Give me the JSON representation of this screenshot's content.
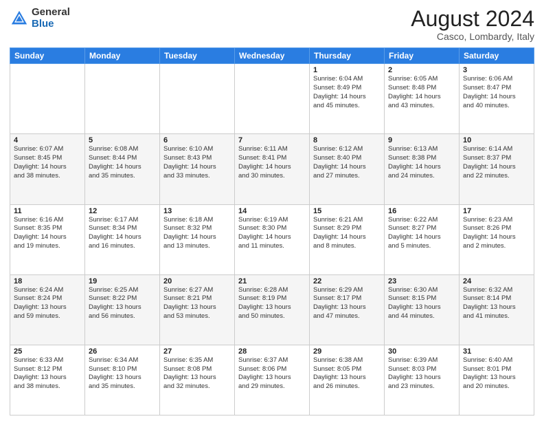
{
  "header": {
    "logo_general": "General",
    "logo_blue": "Blue",
    "month_title": "August 2024",
    "location": "Casco, Lombardy, Italy"
  },
  "weekdays": [
    "Sunday",
    "Monday",
    "Tuesday",
    "Wednesday",
    "Thursday",
    "Friday",
    "Saturday"
  ],
  "weeks": [
    [
      {
        "day": "",
        "info": ""
      },
      {
        "day": "",
        "info": ""
      },
      {
        "day": "",
        "info": ""
      },
      {
        "day": "",
        "info": ""
      },
      {
        "day": "1",
        "info": "Sunrise: 6:04 AM\nSunset: 8:49 PM\nDaylight: 14 hours\nand 45 minutes."
      },
      {
        "day": "2",
        "info": "Sunrise: 6:05 AM\nSunset: 8:48 PM\nDaylight: 14 hours\nand 43 minutes."
      },
      {
        "day": "3",
        "info": "Sunrise: 6:06 AM\nSunset: 8:47 PM\nDaylight: 14 hours\nand 40 minutes."
      }
    ],
    [
      {
        "day": "4",
        "info": "Sunrise: 6:07 AM\nSunset: 8:45 PM\nDaylight: 14 hours\nand 38 minutes."
      },
      {
        "day": "5",
        "info": "Sunrise: 6:08 AM\nSunset: 8:44 PM\nDaylight: 14 hours\nand 35 minutes."
      },
      {
        "day": "6",
        "info": "Sunrise: 6:10 AM\nSunset: 8:43 PM\nDaylight: 14 hours\nand 33 minutes."
      },
      {
        "day": "7",
        "info": "Sunrise: 6:11 AM\nSunset: 8:41 PM\nDaylight: 14 hours\nand 30 minutes."
      },
      {
        "day": "8",
        "info": "Sunrise: 6:12 AM\nSunset: 8:40 PM\nDaylight: 14 hours\nand 27 minutes."
      },
      {
        "day": "9",
        "info": "Sunrise: 6:13 AM\nSunset: 8:38 PM\nDaylight: 14 hours\nand 24 minutes."
      },
      {
        "day": "10",
        "info": "Sunrise: 6:14 AM\nSunset: 8:37 PM\nDaylight: 14 hours\nand 22 minutes."
      }
    ],
    [
      {
        "day": "11",
        "info": "Sunrise: 6:16 AM\nSunset: 8:35 PM\nDaylight: 14 hours\nand 19 minutes."
      },
      {
        "day": "12",
        "info": "Sunrise: 6:17 AM\nSunset: 8:34 PM\nDaylight: 14 hours\nand 16 minutes."
      },
      {
        "day": "13",
        "info": "Sunrise: 6:18 AM\nSunset: 8:32 PM\nDaylight: 14 hours\nand 13 minutes."
      },
      {
        "day": "14",
        "info": "Sunrise: 6:19 AM\nSunset: 8:30 PM\nDaylight: 14 hours\nand 11 minutes."
      },
      {
        "day": "15",
        "info": "Sunrise: 6:21 AM\nSunset: 8:29 PM\nDaylight: 14 hours\nand 8 minutes."
      },
      {
        "day": "16",
        "info": "Sunrise: 6:22 AM\nSunset: 8:27 PM\nDaylight: 14 hours\nand 5 minutes."
      },
      {
        "day": "17",
        "info": "Sunrise: 6:23 AM\nSunset: 8:26 PM\nDaylight: 14 hours\nand 2 minutes."
      }
    ],
    [
      {
        "day": "18",
        "info": "Sunrise: 6:24 AM\nSunset: 8:24 PM\nDaylight: 13 hours\nand 59 minutes."
      },
      {
        "day": "19",
        "info": "Sunrise: 6:25 AM\nSunset: 8:22 PM\nDaylight: 13 hours\nand 56 minutes."
      },
      {
        "day": "20",
        "info": "Sunrise: 6:27 AM\nSunset: 8:21 PM\nDaylight: 13 hours\nand 53 minutes."
      },
      {
        "day": "21",
        "info": "Sunrise: 6:28 AM\nSunset: 8:19 PM\nDaylight: 13 hours\nand 50 minutes."
      },
      {
        "day": "22",
        "info": "Sunrise: 6:29 AM\nSunset: 8:17 PM\nDaylight: 13 hours\nand 47 minutes."
      },
      {
        "day": "23",
        "info": "Sunrise: 6:30 AM\nSunset: 8:15 PM\nDaylight: 13 hours\nand 44 minutes."
      },
      {
        "day": "24",
        "info": "Sunrise: 6:32 AM\nSunset: 8:14 PM\nDaylight: 13 hours\nand 41 minutes."
      }
    ],
    [
      {
        "day": "25",
        "info": "Sunrise: 6:33 AM\nSunset: 8:12 PM\nDaylight: 13 hours\nand 38 minutes."
      },
      {
        "day": "26",
        "info": "Sunrise: 6:34 AM\nSunset: 8:10 PM\nDaylight: 13 hours\nand 35 minutes."
      },
      {
        "day": "27",
        "info": "Sunrise: 6:35 AM\nSunset: 8:08 PM\nDaylight: 13 hours\nand 32 minutes."
      },
      {
        "day": "28",
        "info": "Sunrise: 6:37 AM\nSunset: 8:06 PM\nDaylight: 13 hours\nand 29 minutes."
      },
      {
        "day": "29",
        "info": "Sunrise: 6:38 AM\nSunset: 8:05 PM\nDaylight: 13 hours\nand 26 minutes."
      },
      {
        "day": "30",
        "info": "Sunrise: 6:39 AM\nSunset: 8:03 PM\nDaylight: 13 hours\nand 23 minutes."
      },
      {
        "day": "31",
        "info": "Sunrise: 6:40 AM\nSunset: 8:01 PM\nDaylight: 13 hours\nand 20 minutes."
      }
    ]
  ]
}
